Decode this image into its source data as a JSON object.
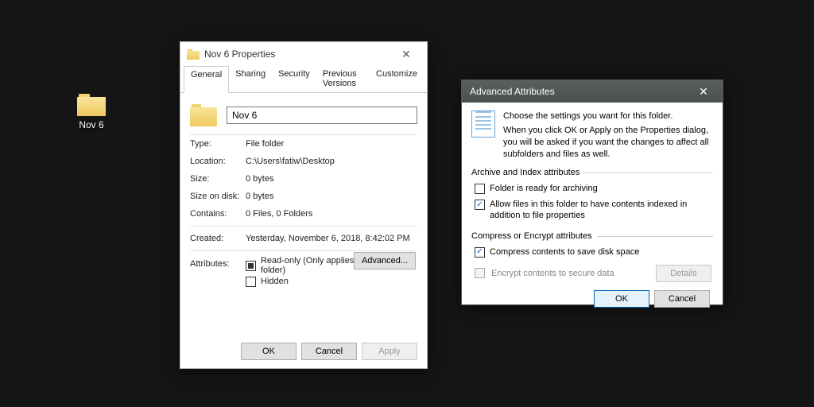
{
  "desktop": {
    "folder_label": "Nov 6"
  },
  "props": {
    "title": "Nov 6 Properties",
    "tabs": {
      "general": "General",
      "sharing": "Sharing",
      "security": "Security",
      "previous": "Previous Versions",
      "customize": "Customize"
    },
    "name_value": "Nov 6",
    "rows": {
      "type_k": "Type:",
      "type_v": "File folder",
      "location_k": "Location:",
      "location_v": "C:\\Users\\fatiw\\Desktop",
      "size_k": "Size:",
      "size_v": "0 bytes",
      "sizeondisk_k": "Size on disk:",
      "sizeondisk_v": "0 bytes",
      "contains_k": "Contains:",
      "contains_v": "0 Files, 0 Folders",
      "created_k": "Created:",
      "created_v": "Yesterday, November 6, 2018, 8:42:02 PM",
      "attributes_k": "Attributes:",
      "readonly": "Read-only (Only applies to files in folder)",
      "hidden": "Hidden",
      "advanced": "Advanced..."
    },
    "buttons": {
      "ok": "OK",
      "cancel": "Cancel",
      "apply": "Apply"
    }
  },
  "adv": {
    "title": "Advanced Attributes",
    "head1": "Choose the settings you want for this folder.",
    "head2": "When you click OK or Apply on the Properties dialog, you will be asked if you want the changes to affect all subfolders and files as well.",
    "group1_label": "Archive and Index attributes",
    "g1_ready": "Folder is ready for archiving",
    "g1_index": "Allow files in this folder to have contents indexed in addition to file properties",
    "group2_label": "Compress or Encrypt attributes",
    "g2_compress": "Compress contents to save disk space",
    "g2_encrypt": "Encrypt contents to secure data",
    "details": "Details",
    "ok": "OK",
    "cancel": "Cancel"
  }
}
